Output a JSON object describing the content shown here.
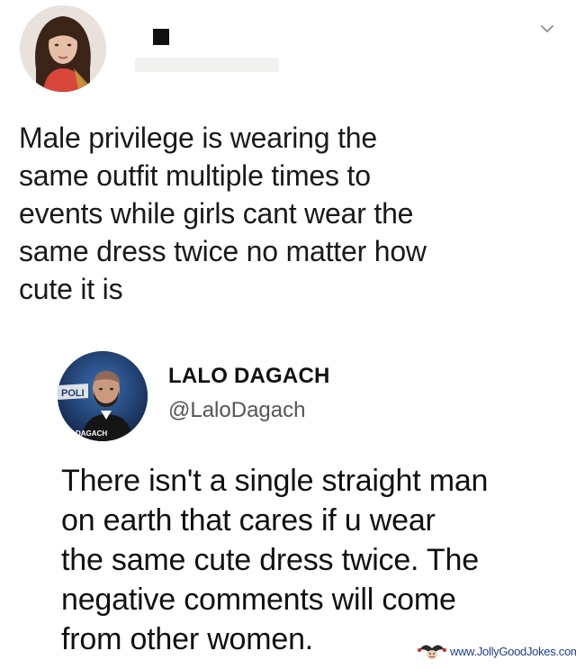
{
  "tweet1": {
    "text": "Male privilege is wearing the\nsame outfit multiple times to\nevents while girls cant wear the\nsame dress twice  no matter how\ncute it is"
  },
  "tweet2": {
    "display_name": "LALO DAGACH",
    "handle": "@LaloDagach",
    "avatar_caption_top": "POLI",
    "avatar_caption_bottom": "DAGACH",
    "text": "There isn't a single straight man\non earth that cares if u wear\nthe same cute dress twice. The\nnegative comments will come\nfrom other women."
  },
  "watermark": {
    "text": "www.JollyGoodJokes.com"
  },
  "icons": {
    "menu": "chevron-down-icon",
    "watermark_logo": "jester-logo-icon"
  },
  "colors": {
    "background": "#ffffff",
    "text": "#1a1a1a",
    "handle": "#555555",
    "watermark": "#1f3e8c"
  }
}
